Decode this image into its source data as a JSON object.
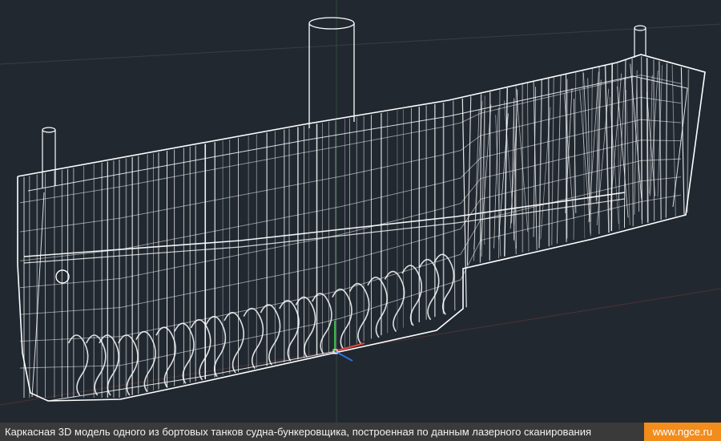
{
  "viewport": {
    "background_color": "#212830",
    "wire_color": "#ffffff",
    "axis_colors": {
      "x": "#e0483c",
      "y": "#3bb54a",
      "z": "#2f6fe0"
    }
  },
  "caption": {
    "text": "Каркасная 3D модель одного из бортовых танков судна-бункеровщика, построенная по данным лазерного сканирования",
    "site": "www.ngce.ru",
    "bar_color": "#3a3a3a",
    "badge_color": "#f28c1c"
  }
}
